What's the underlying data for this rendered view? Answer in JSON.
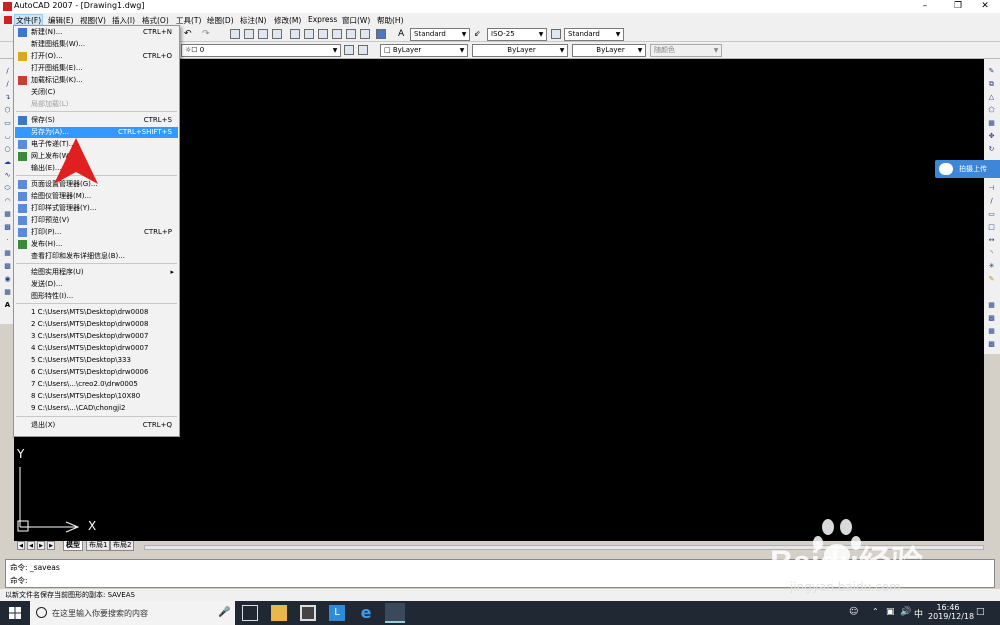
{
  "window": {
    "title": "AutoCAD 2007 - [Drawing1.dwg]"
  },
  "menubar": [
    "文件(F)",
    "编辑(E)",
    "视图(V)",
    "插入(I)",
    "格式(O)",
    "工具(T)",
    "绘图(D)",
    "标注(N)",
    "修改(M)",
    "Express",
    "窗口(W)",
    "帮助(H)"
  ],
  "toolbar": {
    "text_style": "Standard",
    "dim_style": "ISO-25",
    "table_style": "Standard",
    "layer": "0",
    "color": "ByLayer",
    "linetype": "ByLayer",
    "lineweight": "ByLayer",
    "plotstyle": "随颜色"
  },
  "file_menu": [
    {
      "label": "新建(N)...",
      "shortcut": "CTRL+N"
    },
    {
      "label": "新建图纸集(W)...",
      "shortcut": ""
    },
    {
      "label": "打开(O)...",
      "shortcut": "CTRL+O"
    },
    {
      "label": "打开图纸集(E)...",
      "shortcut": ""
    },
    {
      "label": "加载标记集(K)...",
      "shortcut": ""
    },
    {
      "label": "关闭(C)",
      "shortcut": ""
    },
    {
      "label": "局部加载(L)",
      "shortcut": ""
    },
    {
      "label": "保存(S)",
      "shortcut": "CTRL+S"
    },
    {
      "label": "另存为(A)...",
      "shortcut": "CTRL+SHIFT+S"
    },
    {
      "label": "电子传递(T)...",
      "shortcut": ""
    },
    {
      "label": "网上发布(W)...",
      "shortcut": ""
    },
    {
      "label": "输出(E)...",
      "shortcut": ""
    },
    {
      "label": "页面设置管理器(G)...",
      "shortcut": ""
    },
    {
      "label": "绘图仪管理器(M)...",
      "shortcut": ""
    },
    {
      "label": "打印样式管理器(Y)...",
      "shortcut": ""
    },
    {
      "label": "打印预览(V)",
      "shortcut": ""
    },
    {
      "label": "打印(P)...",
      "shortcut": "CTRL+P"
    },
    {
      "label": "发布(H)...",
      "shortcut": ""
    },
    {
      "label": "查看打印和发布详细信息(B)...",
      "shortcut": ""
    },
    {
      "label": "绘图实用程序(U)",
      "shortcut": ""
    },
    {
      "label": "发送(D)...",
      "shortcut": ""
    },
    {
      "label": "图形特性(I)...",
      "shortcut": ""
    },
    {
      "label": "1 C:\\Users\\MTS\\Desktop\\drw0008",
      "shortcut": ""
    },
    {
      "label": "2 C:\\Users\\MTS\\Desktop\\drw0008",
      "shortcut": ""
    },
    {
      "label": "3 C:\\Users\\MTS\\Desktop\\drw0007",
      "shortcut": ""
    },
    {
      "label": "4 C:\\Users\\MTS\\Desktop\\drw0007",
      "shortcut": ""
    },
    {
      "label": "5 C:\\Users\\MTS\\Desktop\\333",
      "shortcut": ""
    },
    {
      "label": "6 C:\\Users\\MTS\\Desktop\\drw0006",
      "shortcut": ""
    },
    {
      "label": "7 C:\\Users\\...\\creo2.0\\drw0005",
      "shortcut": ""
    },
    {
      "label": "8 C:\\Users\\MTS\\Desktop\\10X80",
      "shortcut": ""
    },
    {
      "label": "9 C:\\Users\\...\\CAD\\chongji2",
      "shortcut": ""
    },
    {
      "label": "退出(X)",
      "shortcut": "CTRL+Q"
    }
  ],
  "ucs": {
    "y": "Y",
    "x": "X"
  },
  "layout_tabs": [
    "模型",
    "布局1",
    "布局2"
  ],
  "command": {
    "line1": "命令:  _saveas",
    "line2": "命令:"
  },
  "status_text": "以新文件名保存当前图形的副本:  SAVEAS",
  "taskbar": {
    "search_placeholder": "在这里输入你要搜索的内容",
    "time": "16:46",
    "date": "2019/12/18",
    "ime": "中"
  },
  "side_ad": "拍摄上传",
  "watermark": {
    "brand": "Baidu经验",
    "url": "jingyan.baidu.com"
  },
  "colors": {
    "canvas": "#000000",
    "highlight": "#3399ff",
    "taskbar": "#1f2833",
    "arrow": "#e02020"
  }
}
